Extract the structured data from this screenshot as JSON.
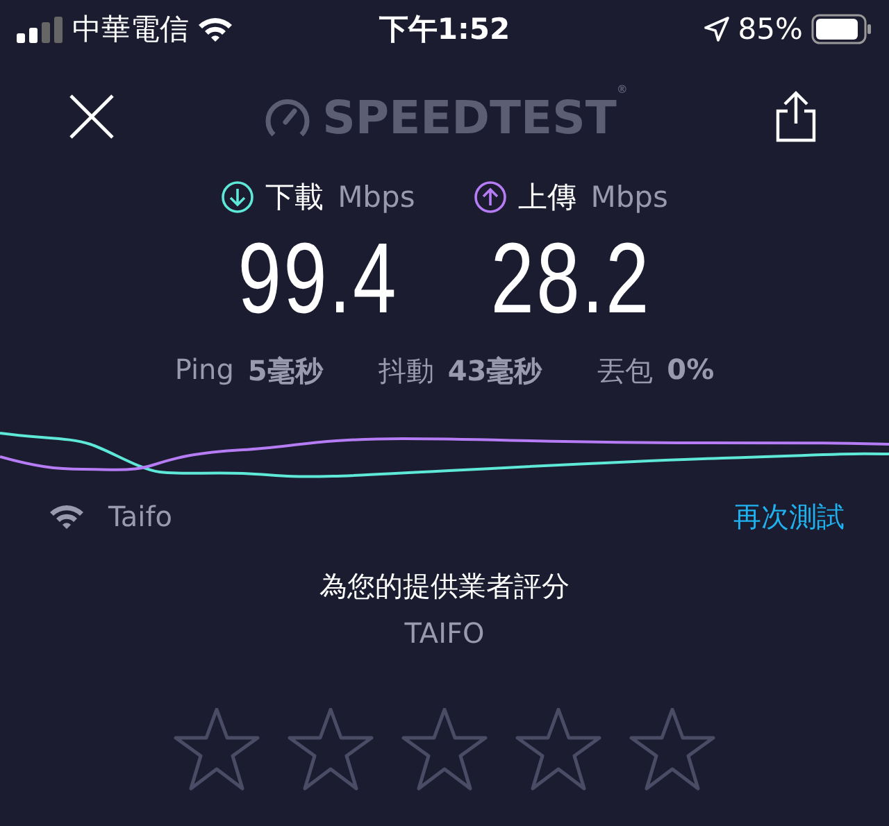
{
  "status_bar": {
    "carrier": "中華電信",
    "time": "下午1:52",
    "battery": "85%"
  },
  "header": {
    "logo": "SPEEDTEST$^{®}$"
  },
  "results": [
    {
      "kind": "download",
      "label": "下載",
      "unit": "Mbps",
      "value": "99.4"
    },
    {
      "kind": "upload",
      "label": "上傳",
      "unit": "Mbps",
      "value": "28.2"
    }
  ],
  "metrics": [
    {
      "label": "Ping",
      "value": "5毫秒"
    },
    {
      "label": "抖動",
      "value": "43毫秒"
    },
    {
      "label": "丟包",
      "value": "0%"
    }
  ],
  "connection": {
    "network": "Taifo",
    "action": "再次測試"
  },
  "rating": {
    "title": "為您的提供業者評分",
    "provider": "TAIFO",
    "stars": 0
  }
}
